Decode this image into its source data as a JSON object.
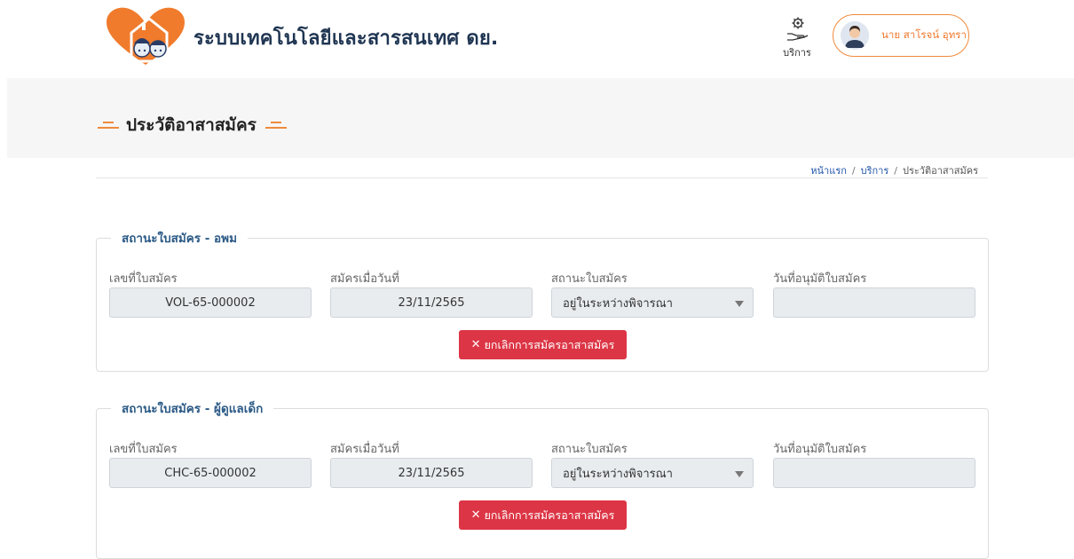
{
  "header": {
    "app_title": "ระบบเทคโนโลยีและสารสนเทศ ดย.",
    "service_label": "บริการ",
    "user_name": "นาย สาโรจน์ อุทรา"
  },
  "page": {
    "title": "ประวัติอาสาสมัคร"
  },
  "breadcrumb": {
    "home": "หน้าแรก",
    "service": "บริการ",
    "current": "ประวัติอาสาสมัคร",
    "separator": "/"
  },
  "labels": {
    "application_no": "เลขที่ใบสมัคร",
    "applied_date": "สมัครเมื่อวันที่",
    "status": "สถานะใบสมัคร",
    "approved_date": "วันที่อนุมัติใบสมัคร",
    "cancel_button": "ยกเลิกการสมัครอาสาสมัคร"
  },
  "applications": [
    {
      "legend": "สถานะใบสมัคร - อพม",
      "application_no": "VOL-65-000002",
      "applied_date": "23/11/2565",
      "status": "อยู่ในระหว่างพิจารณา",
      "approved_date": ""
    },
    {
      "legend": "สถานะใบสมัคร - ผู้ดูแลเด็ก",
      "application_no": "CHC-65-000002",
      "applied_date": "23/11/2565",
      "status": "อยู่ในระหว่างพิจารณา",
      "approved_date": ""
    }
  ],
  "colors": {
    "accent_orange": "#f08a3c",
    "legend_blue": "#2c5a86",
    "danger_red": "#dc3545"
  }
}
